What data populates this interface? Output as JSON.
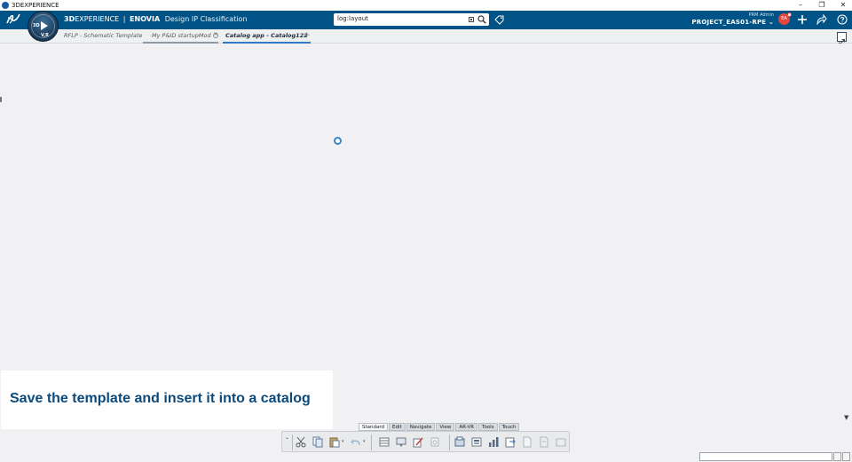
{
  "window": {
    "title": "3DEXPERIENCE",
    "controls": [
      "–",
      "❐",
      "✕"
    ]
  },
  "topbar": {
    "brand_3d": "3D",
    "brand_experience": "EXPERIENCE",
    "brand_sep": "|",
    "brand_product": "ENOVIA",
    "brand_app": "Design IP Classification",
    "compass_3d": "3D",
    "compass_vr": "V,R",
    "search_value": "log:layout",
    "user_role": "PRM Admin",
    "project": "PROJECT_EAS01-RPE",
    "avatar_initials": "EA",
    "brand_color": "#005386"
  },
  "tabs": [
    {
      "label": "RFLP - Schematic Template",
      "state": "inactive"
    },
    {
      "label": "My P&ID startupMod",
      "state": "mid",
      "closable": true
    },
    {
      "label": "Catalog app - Catalog122",
      "state": "active"
    }
  ],
  "caption": "Save the template and insert it into a catalog",
  "action_bar": {
    "tabs": [
      "Standard",
      "Edit",
      "Navigate",
      "View",
      "AR-VR",
      "Tools",
      "Touch"
    ],
    "active_tab": "Standard",
    "icons": [
      "cut-icon",
      "copy-icon",
      "paste-icon",
      "undo-icon",
      "table-icon",
      "form-icon",
      "edit-icon",
      "update-icon",
      "catalog-icon",
      "sheet-icon",
      "chart-icon",
      "export-icon",
      "document-icon",
      "document2-icon",
      "document3-icon"
    ]
  }
}
